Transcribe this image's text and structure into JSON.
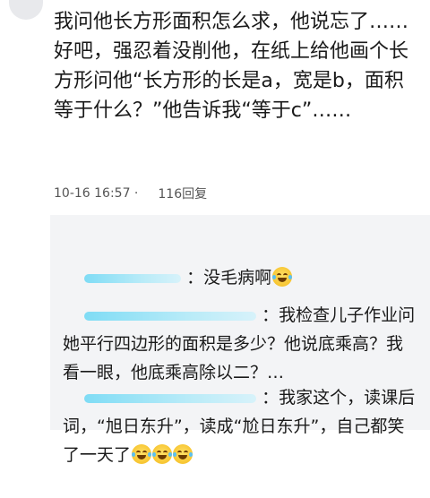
{
  "post": {
    "text": "我问他长方形面积怎么求，他说忘了……好吧，强忍着没削他，在纸上给他画个长方形问他“长方形的长是a，宽是b，面积等于什么？”他告诉我“等于c”……",
    "time": "10-16 16:57 ·",
    "replies": "116回复"
  },
  "comments": [
    {
      "text": "：没毛病啊",
      "emoji_count": 1
    },
    {
      "text": "：我检查儿子作业问她平行四边形的面积是多少？他说底乘高？我看一眼，他底乘高除以二？…",
      "emoji_count": 0
    },
    {
      "text": "：我家这个，读课后词，“旭日东升”，读成“尬日东升”，自己都笑了一天了",
      "emoji_count": 3
    }
  ],
  "icons": {
    "redaction": "redacted-username",
    "emoji": "laughing-tears-emoji"
  },
  "colors": {
    "redaction": "#7fdcf5",
    "comment_bg": "#f3f4f6"
  }
}
